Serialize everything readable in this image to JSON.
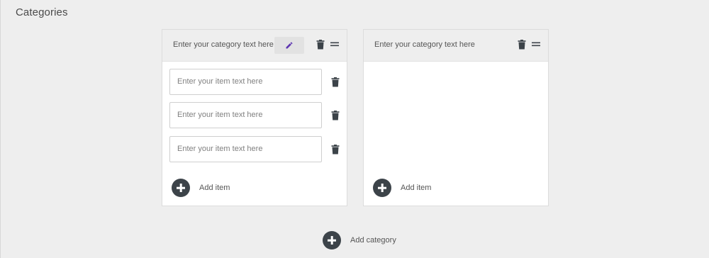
{
  "page": {
    "title": "Categories"
  },
  "categories": [
    {
      "title": "Enter your category text here",
      "items": [
        {
          "placeholder": "Enter your item text here"
        },
        {
          "placeholder": "Enter your item text here"
        },
        {
          "placeholder": "Enter your item text here"
        }
      ],
      "add_item_label": "Add item"
    },
    {
      "title": "Enter your category text here",
      "items": [],
      "add_item_label": "Add item"
    }
  ],
  "footer": {
    "add_category_label": "Add category"
  },
  "icons": {
    "edit": "pencil-icon",
    "delete": "trash-icon",
    "drag": "drag-handle-icon",
    "add": "plus-circle-icon"
  },
  "colors": {
    "background": "#eeeeee",
    "card": "#ffffff",
    "icon_dark": "#3c4349",
    "edit_accent": "#5e35b1"
  }
}
